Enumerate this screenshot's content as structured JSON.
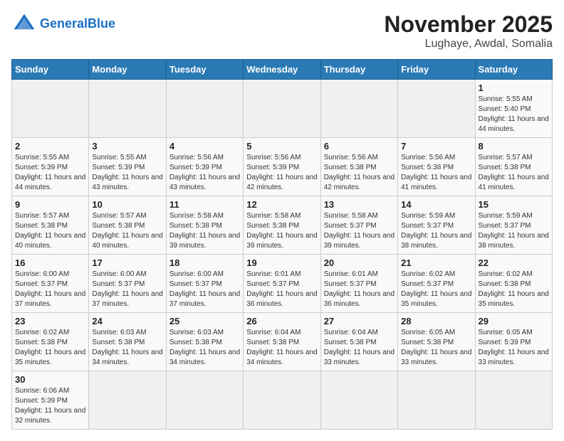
{
  "header": {
    "logo_general": "General",
    "logo_blue": "Blue",
    "title": "November 2025",
    "subtitle": "Lughaye, Awdal, Somalia"
  },
  "calendar": {
    "days_of_week": [
      "Sunday",
      "Monday",
      "Tuesday",
      "Wednesday",
      "Thursday",
      "Friday",
      "Saturday"
    ],
    "weeks": [
      [
        {
          "day": "",
          "info": ""
        },
        {
          "day": "",
          "info": ""
        },
        {
          "day": "",
          "info": ""
        },
        {
          "day": "",
          "info": ""
        },
        {
          "day": "",
          "info": ""
        },
        {
          "day": "",
          "info": ""
        },
        {
          "day": "1",
          "info": "Sunrise: 5:55 AM\nSunset: 5:40 PM\nDaylight: 11 hours and 44 minutes."
        }
      ],
      [
        {
          "day": "2",
          "info": "Sunrise: 5:55 AM\nSunset: 5:39 PM\nDaylight: 11 hours and 44 minutes."
        },
        {
          "day": "3",
          "info": "Sunrise: 5:55 AM\nSunset: 5:39 PM\nDaylight: 11 hours and 43 minutes."
        },
        {
          "day": "4",
          "info": "Sunrise: 5:56 AM\nSunset: 5:39 PM\nDaylight: 11 hours and 43 minutes."
        },
        {
          "day": "5",
          "info": "Sunrise: 5:56 AM\nSunset: 5:39 PM\nDaylight: 11 hours and 42 minutes."
        },
        {
          "day": "6",
          "info": "Sunrise: 5:56 AM\nSunset: 5:38 PM\nDaylight: 11 hours and 42 minutes."
        },
        {
          "day": "7",
          "info": "Sunrise: 5:56 AM\nSunset: 5:38 PM\nDaylight: 11 hours and 41 minutes."
        },
        {
          "day": "8",
          "info": "Sunrise: 5:57 AM\nSunset: 5:38 PM\nDaylight: 11 hours and 41 minutes."
        }
      ],
      [
        {
          "day": "9",
          "info": "Sunrise: 5:57 AM\nSunset: 5:38 PM\nDaylight: 11 hours and 40 minutes."
        },
        {
          "day": "10",
          "info": "Sunrise: 5:57 AM\nSunset: 5:38 PM\nDaylight: 11 hours and 40 minutes."
        },
        {
          "day": "11",
          "info": "Sunrise: 5:58 AM\nSunset: 5:38 PM\nDaylight: 11 hours and 39 minutes."
        },
        {
          "day": "12",
          "info": "Sunrise: 5:58 AM\nSunset: 5:38 PM\nDaylight: 11 hours and 39 minutes."
        },
        {
          "day": "13",
          "info": "Sunrise: 5:58 AM\nSunset: 5:37 PM\nDaylight: 11 hours and 39 minutes."
        },
        {
          "day": "14",
          "info": "Sunrise: 5:59 AM\nSunset: 5:37 PM\nDaylight: 11 hours and 38 minutes."
        },
        {
          "day": "15",
          "info": "Sunrise: 5:59 AM\nSunset: 5:37 PM\nDaylight: 11 hours and 38 minutes."
        }
      ],
      [
        {
          "day": "16",
          "info": "Sunrise: 6:00 AM\nSunset: 5:37 PM\nDaylight: 11 hours and 37 minutes."
        },
        {
          "day": "17",
          "info": "Sunrise: 6:00 AM\nSunset: 5:37 PM\nDaylight: 11 hours and 37 minutes."
        },
        {
          "day": "18",
          "info": "Sunrise: 6:00 AM\nSunset: 5:37 PM\nDaylight: 11 hours and 37 minutes."
        },
        {
          "day": "19",
          "info": "Sunrise: 6:01 AM\nSunset: 5:37 PM\nDaylight: 11 hours and 36 minutes."
        },
        {
          "day": "20",
          "info": "Sunrise: 6:01 AM\nSunset: 5:37 PM\nDaylight: 11 hours and 36 minutes."
        },
        {
          "day": "21",
          "info": "Sunrise: 6:02 AM\nSunset: 5:37 PM\nDaylight: 11 hours and 35 minutes."
        },
        {
          "day": "22",
          "info": "Sunrise: 6:02 AM\nSunset: 5:38 PM\nDaylight: 11 hours and 35 minutes."
        }
      ],
      [
        {
          "day": "23",
          "info": "Sunrise: 6:02 AM\nSunset: 5:38 PM\nDaylight: 11 hours and 35 minutes."
        },
        {
          "day": "24",
          "info": "Sunrise: 6:03 AM\nSunset: 5:38 PM\nDaylight: 11 hours and 34 minutes."
        },
        {
          "day": "25",
          "info": "Sunrise: 6:03 AM\nSunset: 5:38 PM\nDaylight: 11 hours and 34 minutes."
        },
        {
          "day": "26",
          "info": "Sunrise: 6:04 AM\nSunset: 5:38 PM\nDaylight: 11 hours and 34 minutes."
        },
        {
          "day": "27",
          "info": "Sunrise: 6:04 AM\nSunset: 5:38 PM\nDaylight: 11 hours and 33 minutes."
        },
        {
          "day": "28",
          "info": "Sunrise: 6:05 AM\nSunset: 5:38 PM\nDaylight: 11 hours and 33 minutes."
        },
        {
          "day": "29",
          "info": "Sunrise: 6:05 AM\nSunset: 5:39 PM\nDaylight: 11 hours and 33 minutes."
        }
      ],
      [
        {
          "day": "30",
          "info": "Sunrise: 6:06 AM\nSunset: 5:39 PM\nDaylight: 11 hours and 32 minutes."
        },
        {
          "day": "",
          "info": ""
        },
        {
          "day": "",
          "info": ""
        },
        {
          "day": "",
          "info": ""
        },
        {
          "day": "",
          "info": ""
        },
        {
          "day": "",
          "info": ""
        },
        {
          "day": "",
          "info": ""
        }
      ]
    ]
  }
}
